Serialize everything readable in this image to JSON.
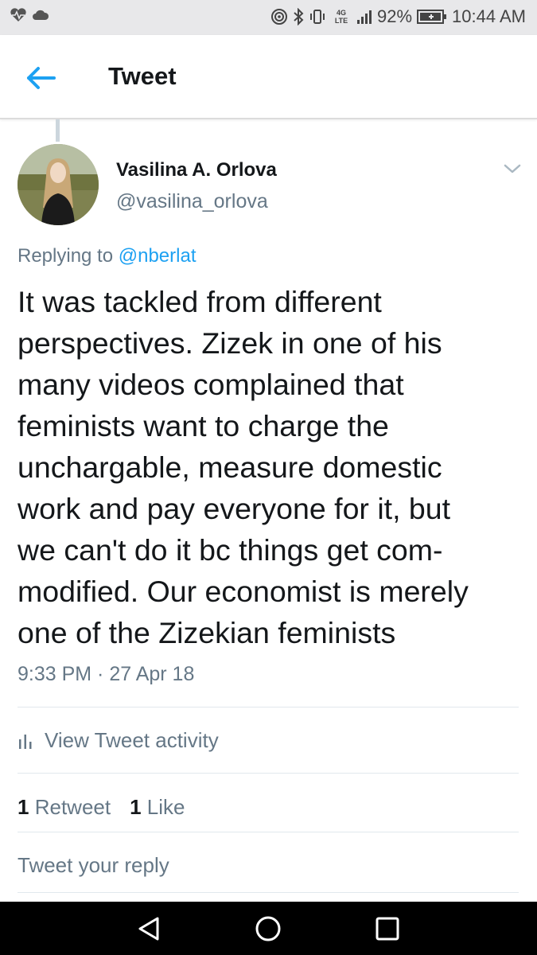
{
  "status_bar": {
    "network_label": "4G LTE",
    "battery": "92%",
    "time": "10:44 AM"
  },
  "app_bar": {
    "title": "Tweet"
  },
  "tweet": {
    "author_name": "Vasilina A. Orlova",
    "author_handle": "@vasilina_orlova",
    "replying_prefix": "Replying to",
    "replying_to": "@nberlat",
    "text_lines": [
      "It was tackled from different",
      "perspectives. Zizek in one of his",
      "many videos complained that",
      "feminists want to charge the",
      "unchargable, measure domestic",
      "work and pay everyone for it, but",
      "we can't do it bc things get com-",
      "modified. Our economist is merely",
      "one of the Zizekian feminists"
    ],
    "timestamp": "9:33 PM · 27 Apr 18",
    "activity_label": "View Tweet activity",
    "retweet_count": "1",
    "retweet_label": "Retweet",
    "like_count": "1",
    "like_label": "Like"
  },
  "reply": {
    "placeholder": "Tweet your reply"
  },
  "colors": {
    "accent": "#1da1f2",
    "secondary_text": "#657786",
    "primary_text": "#14171a"
  }
}
